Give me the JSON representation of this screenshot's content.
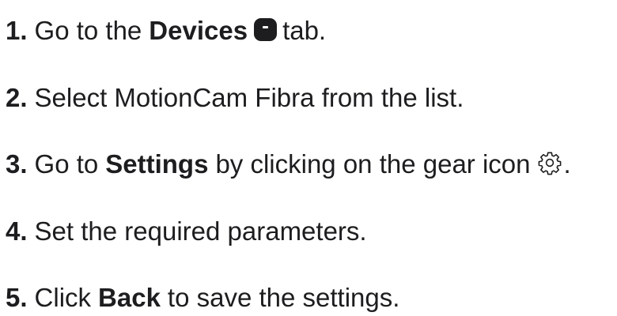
{
  "steps": [
    {
      "num": "1.",
      "pre": "Go to the",
      "bold": "Devices",
      "post": "tab.",
      "icon": "devices-icon"
    },
    {
      "num": "2.",
      "text": "Select MotionCam Fibra from the list."
    },
    {
      "num": "3.",
      "pre": "Go to",
      "bold": "Settings",
      "post": "by clicking on the gear icon",
      "tail": ".",
      "icon": "gear-icon"
    },
    {
      "num": "4.",
      "text": "Set the required parameters."
    },
    {
      "num": "5.",
      "pre": "Click",
      "bold": "Back",
      "post": "to save the settings."
    }
  ]
}
